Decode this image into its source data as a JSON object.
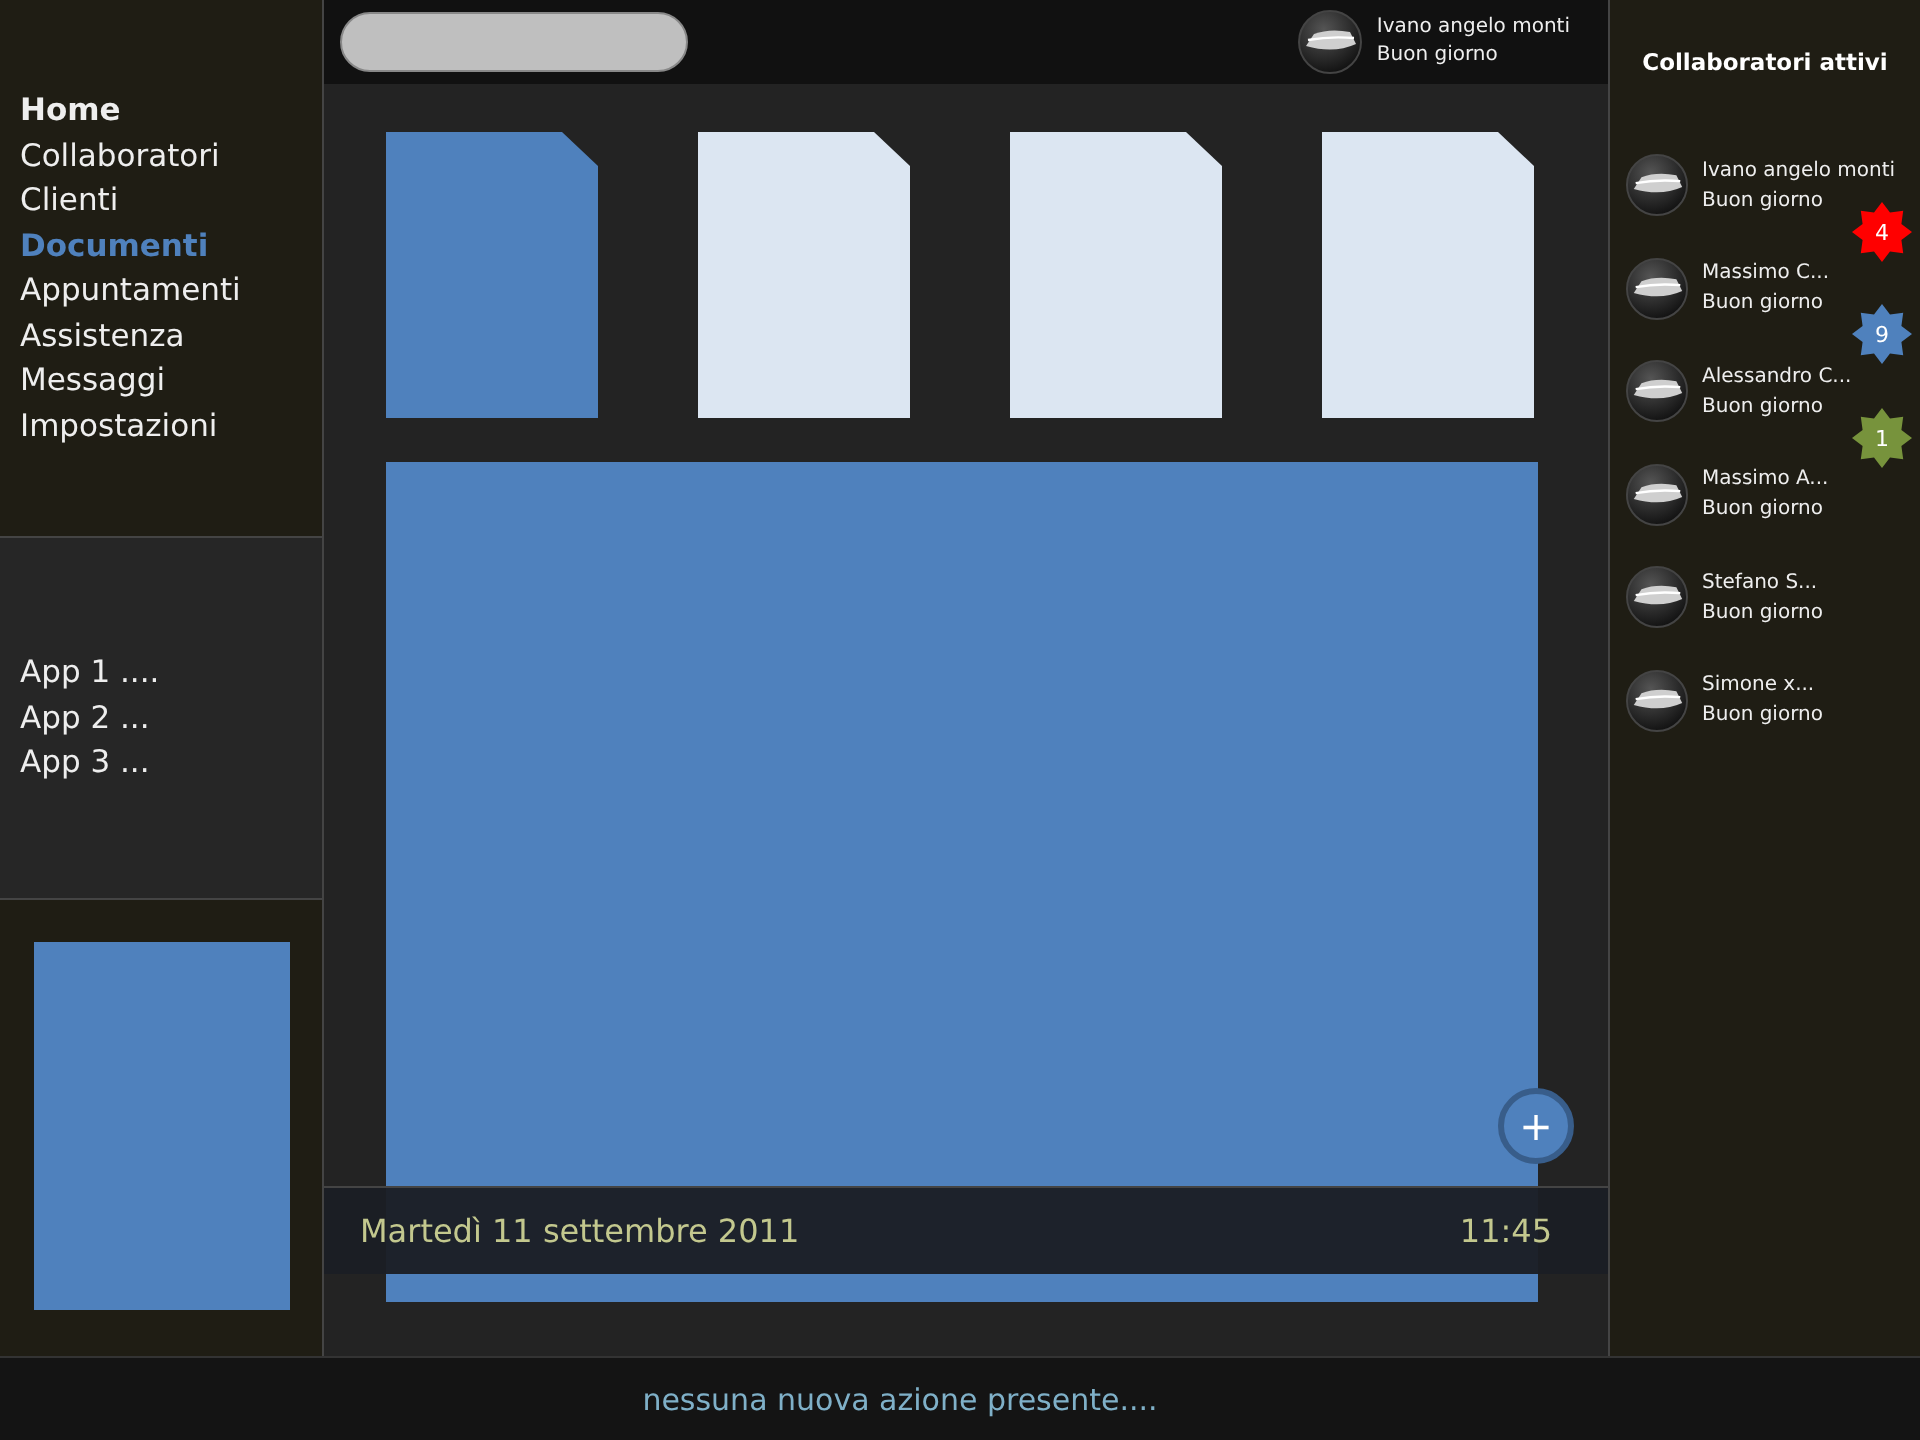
{
  "sidebar": {
    "nav_items": [
      {
        "label": "Home",
        "kind": "heading",
        "selected": false
      },
      {
        "label": "Collaboratori",
        "kind": "link",
        "selected": false
      },
      {
        "label": "Clienti",
        "kind": "link",
        "selected": false
      },
      {
        "label": "Documenti",
        "kind": "link",
        "selected": true
      },
      {
        "label": "Appuntamenti",
        "kind": "link",
        "selected": false
      },
      {
        "label": "Assistenza",
        "kind": "link",
        "selected": false
      },
      {
        "label": "Messaggi",
        "kind": "link",
        "selected": false
      },
      {
        "label": "Impostazioni",
        "kind": "link",
        "selected": false
      }
    ],
    "apps": [
      "App 1 ....",
      "App 2 ...",
      "App 3 ..."
    ]
  },
  "header": {
    "user": {
      "name": "Ivano angelo monti",
      "greeting": "Buon giorno"
    }
  },
  "documents": [
    {
      "selected": true
    },
    {
      "selected": false
    },
    {
      "selected": false
    },
    {
      "selected": false
    }
  ],
  "footer": {
    "date": "Martedì 11 settembre 2011",
    "time": "11:45",
    "add_button": "+"
  },
  "collaborators": {
    "title": "Collaboratori attivi",
    "items": [
      {
        "name": "Ivano angelo monti",
        "greeting": "Buon giorno"
      },
      {
        "name": "Massimo C...",
        "greeting": "Buon giorno",
        "badge": "4",
        "color": "#ff0000"
      },
      {
        "name": "Alessandro  C...",
        "greeting": "Buon giorno",
        "badge": "9",
        "color": "#4f81bd"
      },
      {
        "name": "Massimo A...",
        "greeting": "Buon giorno",
        "badge": "1",
        "color": "#77933c"
      },
      {
        "name": "Stefano S...",
        "greeting": "Buon giorno"
      },
      {
        "name": "Simone x...",
        "greeting": "Buon giorno"
      }
    ]
  },
  "status_bar": {
    "message": "nessuna nuova azione presente...."
  }
}
